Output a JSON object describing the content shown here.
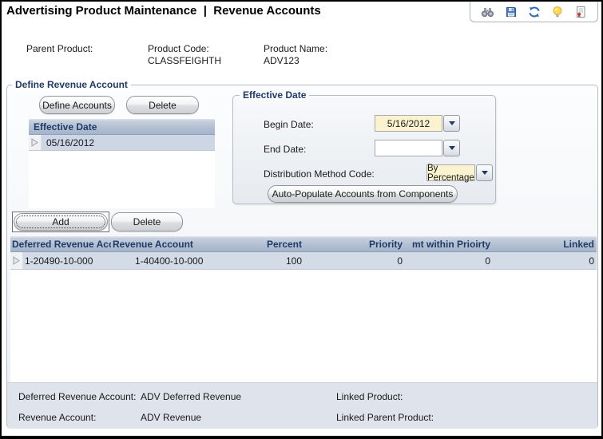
{
  "header": {
    "title": "Advertising Product Maintenance  |  Revenue Accounts",
    "toolbar_icons": [
      "binoculars-icon",
      "save-icon",
      "refresh-icon",
      "lightbulb-icon",
      "report-icon"
    ]
  },
  "info": {
    "parent_product_label": "Parent Product:",
    "parent_product_value": "",
    "product_code_label": "Product Code:",
    "product_code_value": "CLASSFEIGHTH",
    "product_name_label": "Product Name:",
    "product_name_value": "ADV123"
  },
  "main_group": {
    "title": "Define Revenue Account"
  },
  "buttons": {
    "define_accounts": "Define Accounts",
    "delete_top": "Delete",
    "add": "Add",
    "delete_grid": "Delete",
    "auto_populate": "Auto-Populate Accounts from Components"
  },
  "effective_list": {
    "header": "Effective Date",
    "rows": [
      "05/16/2012"
    ]
  },
  "effective_group": {
    "title": "Effective Date",
    "begin_date_label": "Begin Date:",
    "begin_date_value": "5/16/2012",
    "end_date_label": "End Date:",
    "end_date_value": "",
    "distribution_label": "Distribution Method Code:",
    "distribution_value": "By Percentage"
  },
  "accounts_table": {
    "columns": [
      "Deferred Revenue Acco",
      "Revenue Account",
      "Percent",
      "Priority",
      "Amt within Prioirty",
      "Linked"
    ],
    "rows": [
      [
        "1-20490-10-000",
        "1-40400-10-000",
        "100",
        "0",
        "0",
        "0"
      ]
    ]
  },
  "footer": {
    "deferred_label": "Deferred Revenue Account:",
    "deferred_value": "ADV Deferred Revenue",
    "revenue_label": "Revenue Account:",
    "revenue_value": "ADV Revenue",
    "linked_product_label": "Linked Product:",
    "linked_product_value": "",
    "linked_parent_label": "Linked Parent Product:",
    "linked_parent_value": ""
  },
  "colors": {
    "accent_navy": "#1f3a68",
    "combo_yellow": "#fbf3cf",
    "grid_header_top": "#c6cfdd",
    "grid_header_bottom": "#a5b4ca",
    "selected_row": "#ccd6e4",
    "footer_bg": "#dee3ec"
  }
}
